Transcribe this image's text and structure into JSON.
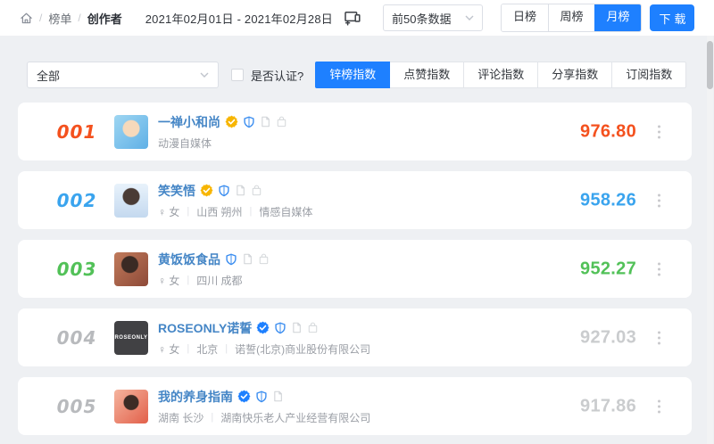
{
  "accent_color": "#1e80ff",
  "topbar": {
    "breadcrumb": {
      "items": [
        "榜单",
        "创作者"
      ],
      "separator": "/"
    },
    "date_range": "2021年02月01日 - 2021年02月28日",
    "limit_dropdown": {
      "value": "前50条数据"
    },
    "period_tabs": [
      {
        "label": "日榜",
        "active": false
      },
      {
        "label": "周榜",
        "active": false
      },
      {
        "label": "月榜",
        "active": true
      }
    ],
    "download_label": "下载"
  },
  "filterbar": {
    "category_dropdown": {
      "value": "全部"
    },
    "verified_checkbox": {
      "label": "是否认证?",
      "checked": false
    },
    "metric_tabs": [
      {
        "label": "锌榜指数",
        "active": true
      },
      {
        "label": "点赞指数",
        "active": false
      },
      {
        "label": "评论指数",
        "active": false
      },
      {
        "label": "分享指数",
        "active": false
      },
      {
        "label": "订阅指数",
        "active": false
      }
    ]
  },
  "ranking": {
    "rows": [
      {
        "rank": "001",
        "rank_color": "#f4511e",
        "name": "一禅小和尚",
        "badges": [
          "check-yellow",
          "shield",
          "file",
          "bag"
        ],
        "gender": null,
        "segments": [
          "动漫自媒体"
        ],
        "score": "976.80",
        "score_color": "#f4511e",
        "avatar": {
          "class": "avatar-monk",
          "text": ""
        }
      },
      {
        "rank": "002",
        "rank_color": "#3aa4ee",
        "name": "笑笑悟",
        "badges": [
          "check-yellow",
          "shield",
          "file",
          "bag"
        ],
        "gender": "女",
        "segments": [
          "山西 朔州",
          "情感自媒体"
        ],
        "score": "958.26",
        "score_color": "#3aa4ee",
        "avatar": {
          "class": "avatar-woman-blue",
          "text": ""
        }
      },
      {
        "rank": "003",
        "rank_color": "#52c158",
        "name": "黄饭饭食品",
        "badges": [
          "shield",
          "file",
          "bag"
        ],
        "gender": "女",
        "segments": [
          "四川 成都"
        ],
        "score": "952.27",
        "score_color": "#52c158",
        "avatar": {
          "class": "avatar-woman-red",
          "text": ""
        }
      },
      {
        "rank": "004",
        "rank_color": "#b8babd",
        "name": "ROSEONLY诺誓",
        "badges": [
          "check-blue",
          "shield",
          "file",
          "bag"
        ],
        "gender": "女",
        "segments": [
          "北京",
          "诺誓(北京)商业股份有限公司"
        ],
        "score": "927.03",
        "score_color": "#caccce",
        "avatar": {
          "class": "avatar-dark-logo",
          "text": "ROSEONLY"
        }
      },
      {
        "rank": "005",
        "rank_color": "#b8babd",
        "name": "我的养身指南",
        "badges": [
          "check-blue",
          "shield",
          "file"
        ],
        "gender": null,
        "segments": [
          "湖南 长沙",
          "湖南快乐老人产业经营有限公司"
        ],
        "score": "917.86",
        "score_color": "#caccce",
        "avatar": {
          "class": "avatar-woman-orange",
          "text": ""
        }
      }
    ],
    "gender_symbol": "♀",
    "divider_symbol": "|"
  }
}
